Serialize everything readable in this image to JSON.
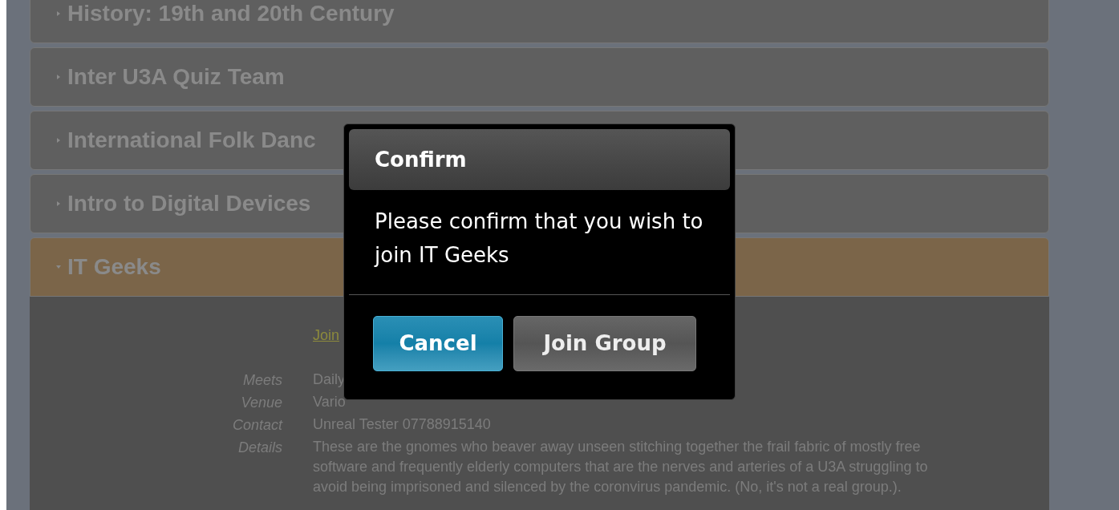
{
  "groups": [
    {
      "title": "History: 19th and 20th Century",
      "expanded": false
    },
    {
      "title": "Inter U3A Quiz Team",
      "expanded": false
    },
    {
      "title": "International Folk Danc",
      "expanded": false
    },
    {
      "title": "Intro to Digital Devices",
      "expanded": false
    },
    {
      "title": "IT Geeks",
      "expanded": true,
      "join_link": "Join",
      "fields": [
        {
          "label": "Meets",
          "value": "Daily"
        },
        {
          "label": "Venue",
          "value": "Vario"
        },
        {
          "label": "Contact",
          "value": "Unreal Tester 07788915140"
        },
        {
          "label": "Details",
          "value": "These are the gnomes who beaver away unseen stitching together the frail fabric of mostly free software and frequently elderly computers that are the nerves and arteries of a U3A struggling to avoid being imprisoned and silenced by the coronvirus pandemic. (No, it's not a real group.)."
        }
      ]
    }
  ],
  "dialog": {
    "title": "Confirm",
    "message": "Please confirm that you wish to join IT Geeks",
    "buttons": [
      {
        "label": "Cancel",
        "kind": "primary"
      },
      {
        "label": "Join Group",
        "kind": "secondary"
      }
    ]
  }
}
